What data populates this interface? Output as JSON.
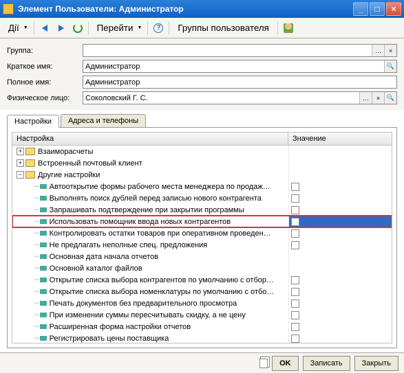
{
  "title": "Элемент Пользователи: Администратор",
  "toolbar": {
    "actions_label": "Дії",
    "go_label": "Перейти",
    "groups_label": "Группы пользователя"
  },
  "form": {
    "group_label": "Группа:",
    "group_value": "",
    "shortname_label": "Краткое имя:",
    "shortname_value": "Администратор",
    "fullname_label": "Полное имя:",
    "fullname_value": "Администратор",
    "person_label": "Физическое лицо:",
    "person_value": "Соколовский Г. С."
  },
  "tabs": {
    "settings": "Настройки",
    "addresses": "Адреса и телефоны"
  },
  "grid": {
    "col1": "Настройка",
    "col2": "Значение",
    "folders": {
      "f1": "Взаиморасчеты",
      "f2": "Встроенный почтовый клиент",
      "f3": "Другие настройки"
    },
    "leaves": [
      "Автооткрытие формы рабочего места менеджера по продаж…",
      "Выполнять поиск дублей перед записью нового контрагента",
      "Запрашивать подтверждение при закрытии программы",
      "Использовать помощник ввода новых контрагентов",
      "Контролировать остатки товаров при оперативном проведен…",
      "Не предлагать неполные спец. предложения",
      "Основная дата начала отчетов",
      "Основной каталог файлов",
      "Открытие списка выбора контрагентов по умолчанию с отбор…",
      "Открытие списка выбора номенклатуры по умолчанию с отбо…",
      "Печать документов без предварительного просмотра",
      "При изменении суммы пересчитывать скидку, а не цену",
      "Расширенная форма настройки отчетов",
      "Регистрировать цены поставщика"
    ]
  },
  "footer": {
    "ok": "OK",
    "save": "Записать",
    "close": "Закрыть"
  }
}
